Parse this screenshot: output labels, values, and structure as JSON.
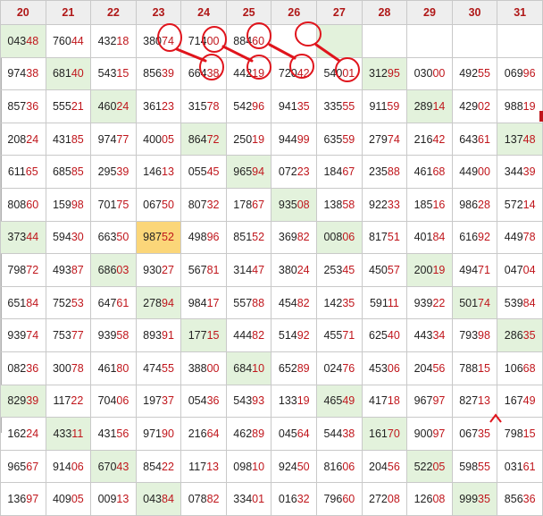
{
  "header": [
    "20",
    "21",
    "22",
    "23",
    "24",
    "25",
    "26",
    "27",
    "28",
    "29",
    "30",
    "31"
  ],
  "rows": [
    [
      "04348",
      "76044",
      "43218",
      "38074",
      "71400",
      "88460",
      "",
      "",
      "",
      "",
      "",
      ""
    ],
    [
      "97438",
      "68140",
      "54315",
      "85639",
      "66438",
      "44219",
      "72042",
      "54001",
      "31295",
      "03000",
      "49255",
      "06996"
    ],
    [
      "85736",
      "55521",
      "46024",
      "36123",
      "31578",
      "54296",
      "94135",
      "33555",
      "91159",
      "28914",
      "42902",
      "98819"
    ],
    [
      "20824",
      "43185",
      "97477",
      "40005",
      "86472",
      "25019",
      "94499",
      "63559",
      "27974",
      "21642",
      "64361",
      "13748"
    ],
    [
      "61165",
      "68585",
      "29539",
      "14613",
      "05545",
      "96594",
      "07223",
      "18467",
      "23588",
      "46168",
      "44900",
      "34439"
    ],
    [
      "80860",
      "15998",
      "70175",
      "06750",
      "80732",
      "17867",
      "93508",
      "13858",
      "92233",
      "18516",
      "98628",
      "57214"
    ],
    [
      "37344",
      "59430",
      "66350",
      "98752",
      "49896",
      "85152",
      "36982",
      "00806",
      "81751",
      "40184",
      "61692",
      "44978"
    ],
    [
      "79872",
      "49387",
      "68603",
      "93027",
      "56781",
      "31447",
      "38024",
      "25345",
      "45057",
      "20019",
      "49471",
      "04704"
    ],
    [
      "65184",
      "75253",
      "64761",
      "27894",
      "98417",
      "55788",
      "45482",
      "14235",
      "59111",
      "93922",
      "50174",
      "53984"
    ],
    [
      "93974",
      "75377",
      "93958",
      "89391",
      "17715",
      "44482",
      "51492",
      "45571",
      "62540",
      "44334",
      "79398",
      "28635"
    ],
    [
      "08236",
      "30078",
      "46180",
      "47455",
      "38800",
      "68410",
      "65289",
      "02476",
      "45306",
      "20456",
      "78815",
      "10668"
    ],
    [
      "82939",
      "11722",
      "70406",
      "19737",
      "05436",
      "54393",
      "13319",
      "46549",
      "41718",
      "96797",
      "82713",
      "16749"
    ],
    [
      "16224",
      "43311",
      "43156",
      "97190",
      "21664",
      "46289",
      "04564",
      "54438",
      "16170",
      "90097",
      "06735",
      "79815"
    ],
    [
      "96567",
      "91406",
      "67043",
      "85422",
      "11713",
      "09810",
      "92450",
      "81606",
      "20456",
      "52205",
      "59855",
      "03161"
    ],
    [
      "13697",
      "40905",
      "00913",
      "04384",
      "07882",
      "33401",
      "01632",
      "79660",
      "27208",
      "12608",
      "99935",
      "85636"
    ]
  ],
  "highlight_green": [
    [
      0,
      0
    ],
    [
      0,
      7
    ],
    [
      1,
      1
    ],
    [
      1,
      8
    ],
    [
      2,
      2
    ],
    [
      2,
      9
    ],
    [
      3,
      4
    ],
    [
      3,
      11
    ],
    [
      4,
      5
    ],
    [
      5,
      6
    ],
    [
      6,
      0
    ],
    [
      6,
      7
    ],
    [
      7,
      2
    ],
    [
      7,
      9
    ],
    [
      8,
      3
    ],
    [
      8,
      10
    ],
    [
      9,
      4
    ],
    [
      9,
      11
    ],
    [
      10,
      5
    ],
    [
      11,
      0
    ],
    [
      11,
      7
    ],
    [
      12,
      1
    ],
    [
      12,
      8
    ],
    [
      13,
      2
    ],
    [
      13,
      9
    ],
    [
      14,
      3
    ],
    [
      14,
      10
    ]
  ],
  "highlight_yellow": [
    [
      6,
      3
    ]
  ],
  "annotation_color": "#e0141c",
  "header_color": "#b01818",
  "highlight_color": "#e3f2dc",
  "yellow_color": "#fbd679"
}
